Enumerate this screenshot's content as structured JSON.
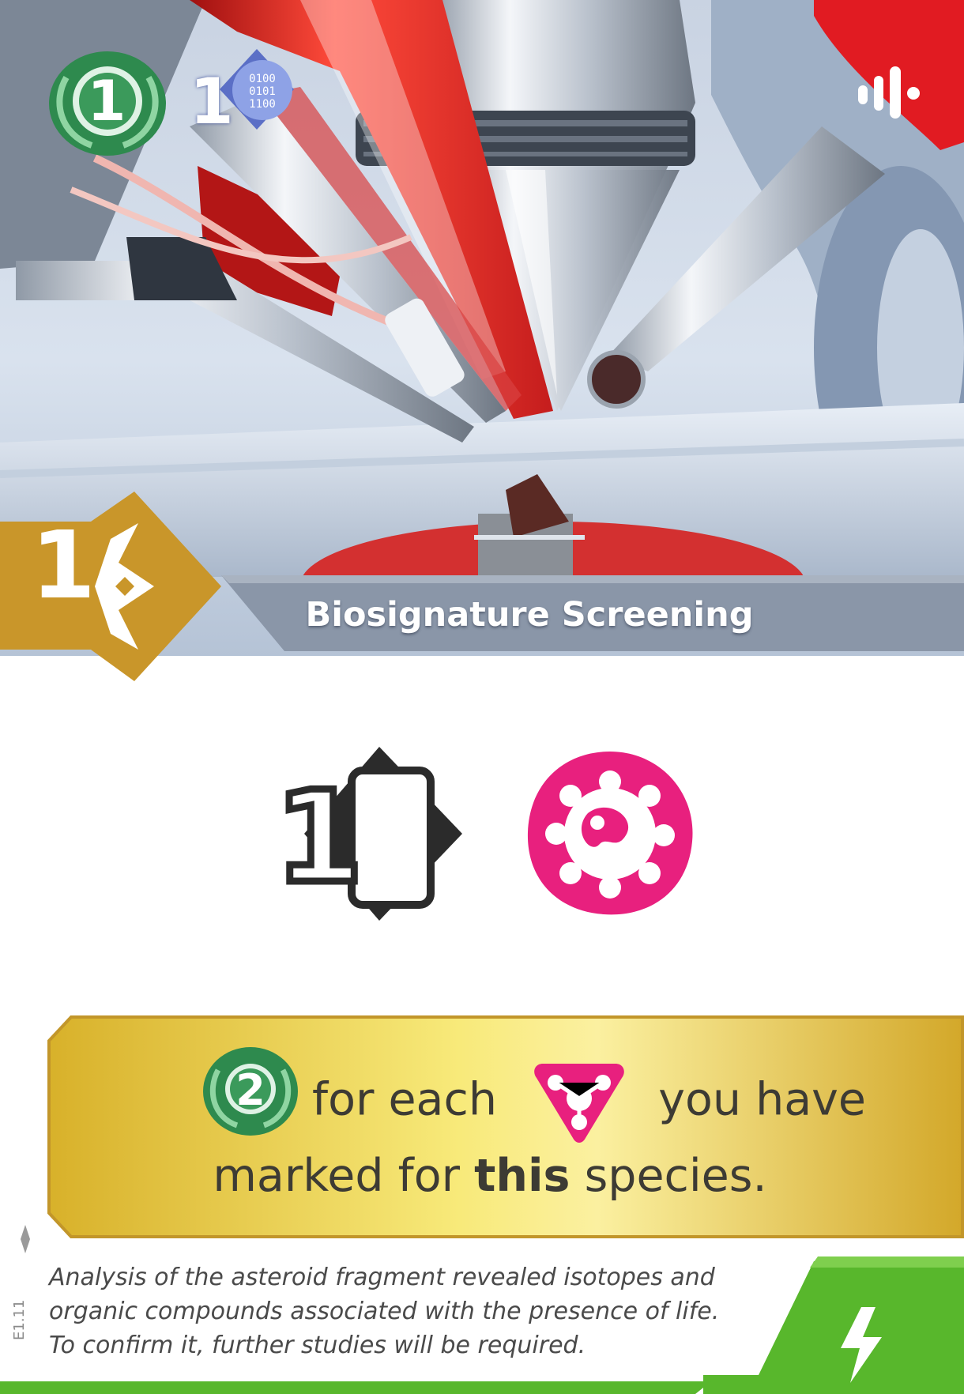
{
  "card": {
    "title": "Biosignature Screening",
    "cost": "1",
    "top_left": {
      "victory_points": "1",
      "data_value": "1",
      "data_icon": "binary-data-icon"
    },
    "top_right_icon": "signal-icon",
    "top_right_color": "#e11b22",
    "requirement": {
      "card_value": "1",
      "card_icon": "card-back-icon",
      "result_icon": "microbe-life-icon",
      "result_color": "#e8207e"
    },
    "effect": {
      "points": "2",
      "text_before_icon": "for each",
      "trace_icon": "life-trace-icon",
      "text_after_icon": "you have",
      "line2_prefix": "marked for",
      "line2_bold": "this",
      "line2_suffix": "species."
    },
    "flavor_text": [
      "Analysis of the asteroid fragment revealed isotopes and",
      "organic compounds associated with the presence of life.",
      "To confirm it, further studies will be required."
    ],
    "card_code": "E1.11",
    "corner_icon": "lightning-icon",
    "colors": {
      "accent_gold": "#c9962a",
      "points_green": "#2e8a4e",
      "corner_green": "#58b72c",
      "title_banner": "#8a96a8"
    }
  }
}
